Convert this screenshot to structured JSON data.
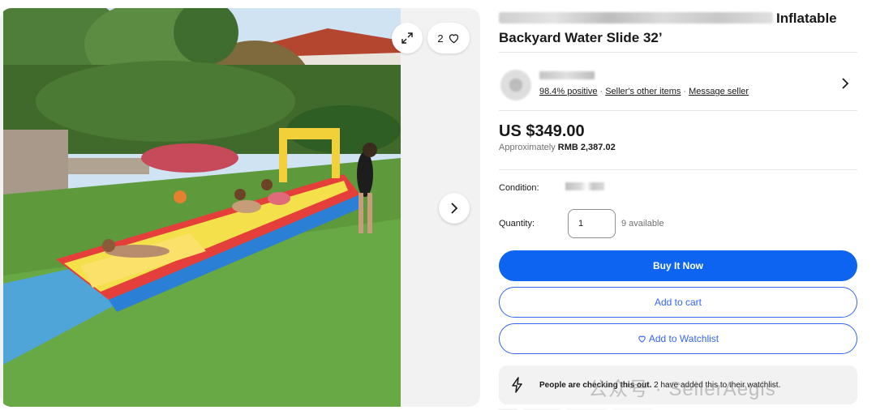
{
  "gallery": {
    "watch_count": "2",
    "icons": {
      "expand": "expand-icon",
      "heart": "heart-icon",
      "next": "chevron-right-icon"
    }
  },
  "listing": {
    "title_visible": "Inflatable Backyard Water Slide 32’"
  },
  "seller": {
    "positive": "98.4% positive",
    "other_items": "Seller's other items",
    "message": "Message seller",
    "separator": "·"
  },
  "price": {
    "main": "US $349.00",
    "approx_prefix": "Approximately",
    "approx_value": "RMB 2,387.02"
  },
  "condition": {
    "label": "Condition:"
  },
  "quantity": {
    "label": "Quantity:",
    "value": "1",
    "available": "9 available"
  },
  "actions": {
    "buy_now": "Buy It Now",
    "add_to_cart": "Add to cart",
    "add_to_watchlist": "Add to Watchlist"
  },
  "notice": {
    "bold": "People are checking this out.",
    "rest": " 2 have added this to their watchlist."
  },
  "watermark": "公众号 · SellerAegis",
  "colors": {
    "primary": "#0c64f0",
    "link_blue": "#3665f3",
    "text": "#191919",
    "muted": "#707070"
  }
}
